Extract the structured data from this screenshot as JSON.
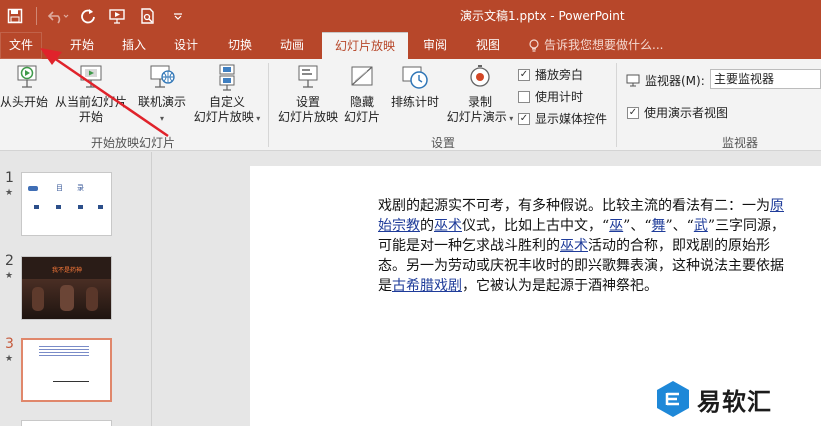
{
  "title_bar": {
    "doc_title": "演示文稿1.pptx - PowerPoint"
  },
  "qat": {
    "icons": [
      "save-icon",
      "undo-icon",
      "redo-icon",
      "present-icon",
      "print-preview-icon"
    ]
  },
  "tabs": [
    {
      "label": "文件"
    },
    {
      "label": "开始"
    },
    {
      "label": "插入"
    },
    {
      "label": "设计"
    },
    {
      "label": "切换"
    },
    {
      "label": "动画"
    },
    {
      "label": "幻灯片放映"
    },
    {
      "label": "审阅"
    },
    {
      "label": "视图"
    }
  ],
  "active_tab": "幻灯片放映",
  "tell_me": "告诉我您想要做什么...",
  "ribbon": {
    "group_start": {
      "label": "开始放映幻灯片",
      "from_beginning": "从头开始",
      "from_current_1": "从当前幻灯片",
      "from_current_2": "开始",
      "online_present": "联机演示",
      "custom_1": "自定义",
      "custom_2": "幻灯片放映"
    },
    "group_setup": {
      "label": "设置",
      "setup_1": "设置",
      "setup_2": "幻灯片放映",
      "hide_1": "隐藏",
      "hide_2": "幻灯片",
      "rehearse": "排练计时",
      "record_1": "录制",
      "record_2": "幻灯片演示",
      "play_narration": "播放旁白",
      "use_timings": "使用计时",
      "show_media": "显示媒体控件",
      "play_narration_checked": true,
      "use_timings_checked": false,
      "show_media_checked": true
    },
    "group_monitors": {
      "label": "监视器",
      "monitor_label": "监视器(M):",
      "monitor_value": "主要监视器",
      "presenter_view": "使用演示者视图",
      "presenter_view_checked": true
    }
  },
  "slides": [
    {
      "number": "1",
      "title": "目　　录"
    },
    {
      "number": "2",
      "title": "我不是药神"
    },
    {
      "number": "3",
      "title": ""
    }
  ],
  "selected_slide": "3",
  "slide_body": {
    "t1": "戏剧的起源实不可考，有多种假说。比较主流的看法有二：一为",
    "l1": "原始宗教",
    "t2": "的",
    "l2": "巫术",
    "t3": "仪式，比如上古中文，“",
    "l3": "巫",
    "t4": "”、“",
    "l4": "舞",
    "t5": "”、“",
    "l5": "武",
    "t6": "”三字同源，可能是对一种乞求战斗胜利的",
    "l6": "巫术",
    "t7": "活动的合称，即戏剧的原始形态。另一为劳动或庆祝丰收时的即兴歌舞表演，这种说法主要依据是",
    "l7": "古希腊戏剧",
    "t8": "，它被认为是起源于酒神祭祀。"
  },
  "watermark": {
    "text": "易软汇"
  },
  "colors": {
    "accent": "#b7472a",
    "arrow": "#e0232b",
    "link": "#1f3c9a"
  }
}
